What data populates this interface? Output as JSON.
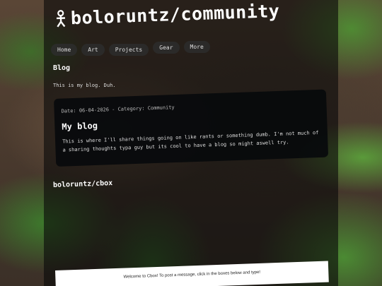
{
  "site": {
    "title": "boloruntz/community"
  },
  "nav": {
    "items": [
      {
        "label": "Home"
      },
      {
        "label": "Art"
      },
      {
        "label": "Projects"
      },
      {
        "label": "Gear"
      },
      {
        "label": "More"
      }
    ]
  },
  "blog": {
    "heading": "Blog",
    "intro": "This is my blog. Duh.",
    "post": {
      "meta": "Date: 06-04-2026 - Category: Community",
      "title": "My blog",
      "body": "This is where I'll share things going on like rants or something dumb. I'm not much of a sharing thoughts typa guy but its cool to have a blog so might aswell try."
    }
  },
  "cbox": {
    "heading": "boloruntz/cbox",
    "welcome": "Welcome to Cbox! To post a message, click in the boxes below and type!"
  },
  "colors": {
    "panel": "#0a0a0a",
    "card": "#080a0c",
    "text": "#e6e6e6",
    "heading": "#ffffff"
  }
}
